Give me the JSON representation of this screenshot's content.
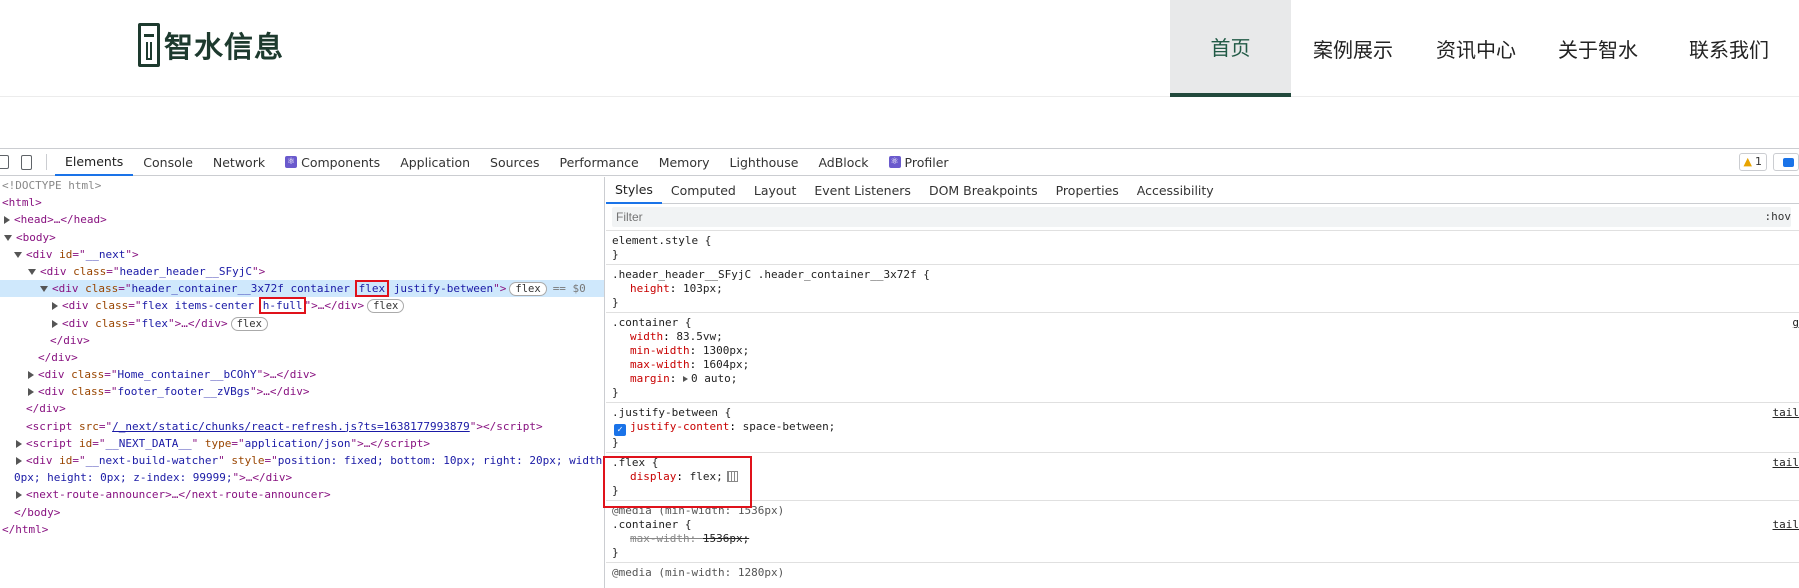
{
  "site": {
    "logo_text": "智水信息",
    "nav": [
      "首页",
      "案例展示",
      "资讯中心",
      "关于智水",
      "联系我们"
    ]
  },
  "devtools": {
    "tabs": [
      "Elements",
      "Console",
      "Network",
      "Components",
      "Application",
      "Sources",
      "Performance",
      "Memory",
      "Lighthouse",
      "AdBlock",
      "Profiler"
    ],
    "warning_count": "1",
    "dom": {
      "doctype": "<!DOCTYPE html>",
      "html_open": "<html>",
      "head": "<head>…</head>",
      "body_open": "<body>",
      "next_div": "__next",
      "header_class": "header_header__SFyjC",
      "container_class_a": "header_container__3x72f container",
      "container_class_flex": "flex",
      "container_class_b": "justify-between",
      "flex_pill": "flex",
      "eq_sel": "== $0",
      "child1_class_a": "flex items-center",
      "child1_class_h": "h-full",
      "child2_class": "flex",
      "div_close": "</div>",
      "home_class": "Home_container__bCOhY",
      "footer_class": "footer_footer__zVBgs",
      "script_src": "/_next/static/chunks/react-refresh.js?ts=1638177993879",
      "script2_id": "__NEXT_DATA__",
      "script2_type": "application/json",
      "watcher_id": "__next-build-watcher",
      "watcher_style_a": "position: fixed; bottom: 10px; right: 20px; width:",
      "watcher_style_b": "0px; height: 0px; z-index: 99999;",
      "route_announcer": "<next-route-announcer>…</next-route-announcer>",
      "body_close": "</body>",
      "html_close": "</html>"
    },
    "styles_tabs": [
      "Styles",
      "Computed",
      "Layout",
      "Event Listeners",
      "DOM Breakpoints",
      "Properties",
      "Accessibility"
    ],
    "filter_placeholder": "Filter",
    "hov": ":hov",
    "rules": {
      "element_style": "element.style {",
      "header_selector": ".header_header__SFyjC .header_container__3x72f {",
      "height": "103px;",
      "container_selector": ".container {",
      "width": "83.5vw;",
      "min_width": "1300px;",
      "max_width": "1604px;",
      "margin": "0 auto;",
      "justify_selector": ".justify-between {",
      "justify_content": "space-between;",
      "flex_selector": ".flex {",
      "display": "flex;",
      "media1": "@media (min-width: 1536px)",
      "container2_selector": ".container {",
      "max_width2": "1536px;",
      "media2": "@media (min-width: 1280px)",
      "src_tail": "tail"
    }
  }
}
